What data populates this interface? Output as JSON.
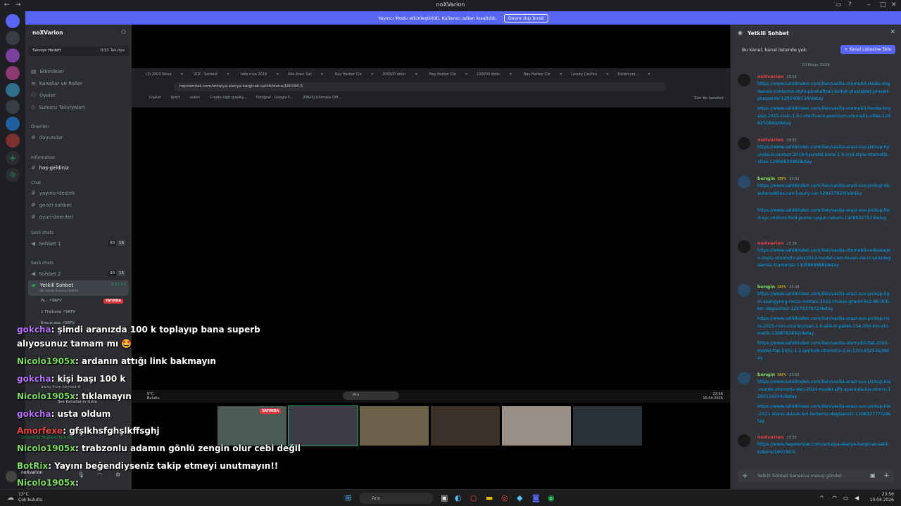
{
  "window": {
    "title": "noXVarion"
  },
  "banner": {
    "text": "Yayıncı Modu etkinleştirildi. Kullanıcı adları kısaltıldı.",
    "button": "Devre dışı bırak"
  },
  "sidebar": {
    "server_name": "noXVarion",
    "boost_label": "Takviye Hedefi",
    "boost_count": "0/33 Takviye",
    "items": [
      "Etkinlikler",
      "Kanallar ve Roller",
      "Üyeler",
      "Sunucu Takviyeleri"
    ],
    "cat_onerilen": "Önerilen",
    "duyurular": "duyurular",
    "cat_information": "Information",
    "hos_geldiniz": "hoş-geldiniz",
    "cat_chat": "Chat",
    "chat_channels": [
      "yayıncı-destek",
      "genel-sohbet",
      "oyun-önerileri"
    ],
    "cat_sesli": "Sesli chats",
    "sohbet1": "Sohbet 1",
    "sohbet1_count": "00",
    "sohbet1_cap": "16",
    "cat_sesli2": "Sesli chats",
    "sohbet2": "Sohbet 2",
    "sohbet2_count": "00",
    "sohbet2_cap": "15",
    "yetkili": "Yetkili Sohbet",
    "yetkili_time": "2:27:15",
    "yetkili_sub": "Bir kanal durumu belirle",
    "live": "YAYINDA",
    "voice_users": [
      "W...",
      "1 Thphone",
      "Emusl.exe"
    ]
  },
  "browser": {
    "tabs": [
      "(3) 2003 Nissa",
      "2CK - Serbest",
      "lada niva 2018",
      "Aile Aracı Sat",
      "Bay Harbor Cle",
      "200500 dolar",
      "Bay Harbor Cle",
      "130000 dolar",
      "Bay Harbor Cle",
      "Luxury Cacilen",
      "Yükleniyor..."
    ],
    "url": "hepsiemlak.com/antalya-alanya-kargicak-satilik/daire/160190-5",
    "bookmarks": [
      "icyalot",
      "Ibroit",
      "ankirt",
      "Create high quality...",
      "Fotoğraf - Google F...",
      "[FM26] Ultimate Diff..."
    ],
    "all_bookmarks": "Tüm Yer İşaretleri"
  },
  "stream_taskbar": {
    "search": "Ara",
    "time": "23:56",
    "date": "10.04.2026",
    "temp": "9°C",
    "weather": "Bulutlu"
  },
  "cam_live": "YAYINDA",
  "overlay": [
    {
      "user": "gokcha",
      "text": ": şimdi aranızda 100 k toplayıp bana superb"
    },
    {
      "user": "",
      "text": "alıyosunuz tamam mı 🤩"
    },
    {
      "user": "Nicolo1905x",
      "text": ": ardanın attığı link bakmayın"
    },
    {
      "user": "gokcha",
      "text": ": kişi başı 100 k"
    },
    {
      "user": "Nicolo1905x",
      "text": ": tıklamayın"
    },
    {
      "user": "gokcha",
      "text": ": usta oldum"
    },
    {
      "user": "Amorfexe",
      "text": ": gfşlkhsfghşlkffsghj"
    },
    {
      "user": "Nicolo1905x",
      "text": ": trabzonlu adamın gönlü zengin olur cebi değil"
    },
    {
      "user": "BotRix",
      "text": ": Yayını beğendiyseniz takip etmeyi unutmayın!!"
    },
    {
      "user": "Nicolo1905x",
      "text": ":"
    }
  ],
  "overlay_misc": {
    "away": "away from keyboard",
    "ses": "Ses Kanallarını Gizle",
    "bag": "Görüntülü Bağlantı Kuruldu"
  },
  "chat": {
    "title": "Yetkili Sohbet",
    "not_listed": "Bu kanal, kanal listende yok.",
    "add_button": "Kanal Listesine Ekle",
    "date": "10 Nisan 2026",
    "messages": [
      {
        "name": "noXvarion",
        "time": "23:18",
        "links": [
          "https://www.sahibinden.com/ilan/vasita-otomobil-skoda-degisensiz-coktemiz-style-plushafizali-koltuk-plustablet-plused-plusperde-1292499136/detay",
          "https://www.sahibinden.com/ilan/vasita-otomobil-honda-boyasiz-2015-civic-1.6-i-vtech-eco-premium-otomatik-vites-1298250840/detay"
        ]
      },
      {
        "name": "noXvarion",
        "time": "23:32",
        "links": [
          "https://www.sahibinden.com/ilan/vasita-arazi-suv-pickup-hyundai-kusursuz-2019-hyundai-kona-1.6-crdi-style-otomatik-vites-1266683586/detay"
        ]
      },
      {
        "name": "bengin",
        "time": "23:32",
        "links": [
          "https://www.sahibinden.com/ilan/vasita-arazi-suv-pickup-ds-automobiles-can-luxury-car-1294379200/detay",
          "https://www.sahibinden.com/ilan/vasita-arazi-suv-pickup-ford-eyc-motors-ford-puma-uygun-rakam-1308632757/detay"
        ]
      },
      {
        "name": "noXvarion",
        "time": "23:38",
        "links": [
          "https://www.sahibinden.com/ilan/vasita-otomobil-volkswagen-soylu-otomotiv-plus2013-model-cam-tavan-vw-cc-plusdegisensiz-tramersiz-1305869688/detay"
        ]
      },
      {
        "name": "bengin",
        "time": "23:38",
        "links": [
          "https://www.sahibinden.com/ilan/vasita-arazi-suv-pickup-kgm-ssangyong-rocco-motors-2022-musso-grand-4x2-86.000-km-degisensiz-1297337872/detay",
          "https://www.sahibinden.com/ilan/vasita-arazi-suv-pickup-mini-2015-mini-countryman-1.6-all4-tr-paket-134.000-km-otomatik-1308782892/detay",
          "https://www.sahibinden.com/ilan/vasita-otomobil-fiat-2020-model-fiat-500c-1.2-senturk-otomotiv-2.el-1301432535/detay"
        ]
      },
      {
        "name": "bengin",
        "time": "23:50",
        "links": [
          "https://www.sahibinden.com/ilan/vasita-arazi-suv-pickup-kia-marde-otomotiv-den-2024-model-sifir-ayarinda-kia-stonic-1292116244/detay",
          "https://www.sahibinden.com/ilan/vasita-arazi-suv-pickup-kia-2021-stonic-dusuk-km-tertemiz-degisensiz-1308327770/detay"
        ]
      },
      {
        "name": "noXvarion",
        "time": "23:55",
        "links": [
          "https://www.hepsiemlak.com/antalya-alanya-kargicak-satilik/daire/160190-5"
        ]
      }
    ],
    "badge": "SRFV",
    "input_placeholder": "Yetkili Sohbet kanalına mesaj gönder"
  },
  "user_panel": {
    "name": "noXvarion"
  },
  "taskbar": {
    "temp": "13°C",
    "weather": "Çok bulutlu",
    "search": "Ara",
    "time": "23:56",
    "date": "10.04.2026"
  }
}
